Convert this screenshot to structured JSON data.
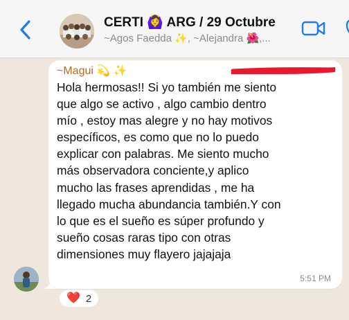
{
  "header": {
    "title": "CERTI 🙆‍♀️ ARG / 29 Octubre",
    "subtitle": "~Agos Faedda ✨, ~Alejandra 🌺,..."
  },
  "message": {
    "sender": "~Magui 💫 ✨",
    "text": "Hola hermosas!! Si yo también me siento\nque algo se activo , algo cambio dentro\nmío , estoy mas alegre y no hay motivos\nespecíficos, es como que no lo puedo\nexplicar con palabras. Me siento mucho\nmás observadora conciente,y aplico\nmucho las frases aprendidas ,  me ha\nllegado mucha abundancia también.Y con\nlo que es el sueño es súper profundo y\nsueño cosas raras  tipo con otras\ndimensiones muy flayero jajajaja",
    "time": "5:51 PM"
  },
  "reaction": {
    "emoji": "❤️",
    "count": "2"
  },
  "icons": {
    "back": "chevron-left-icon",
    "video": "video-camera-icon",
    "call": "phone-icon",
    "heart": "heart-icon"
  },
  "colors": {
    "accent": "#1f7aec",
    "sender_name": "#b76b1f",
    "chat_background": "#efe7de",
    "bubble": "#ffffff",
    "redaction": "#e8192c"
  }
}
